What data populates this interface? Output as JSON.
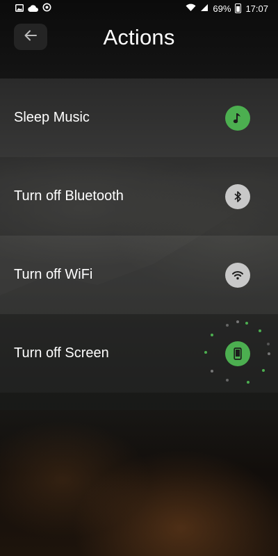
{
  "status_bar": {
    "battery_percent": "69%",
    "time": "17:07",
    "left_icons": [
      "image-icon",
      "cloud-icon",
      "sync-icon"
    ],
    "right_icons": [
      "wifi-icon",
      "signal-icon",
      "battery-icon"
    ]
  },
  "header": {
    "title": "Actions",
    "back_icon": "arrow-left-icon"
  },
  "colors": {
    "active_green": "#4caf50",
    "inactive_gray": "#c8c8c8",
    "icon_dark": "#1c1c1c"
  },
  "actions": [
    {
      "label": "Sleep Music",
      "icon": "music-note-icon",
      "state": "active"
    },
    {
      "label": "Turn off Bluetooth",
      "icon": "bluetooth-icon",
      "state": "inactive"
    },
    {
      "label": "Turn off WiFi",
      "icon": "wifi-icon",
      "state": "inactive"
    },
    {
      "label": "Turn off Screen",
      "icon": "phone-icon",
      "state": "in-progress"
    }
  ]
}
